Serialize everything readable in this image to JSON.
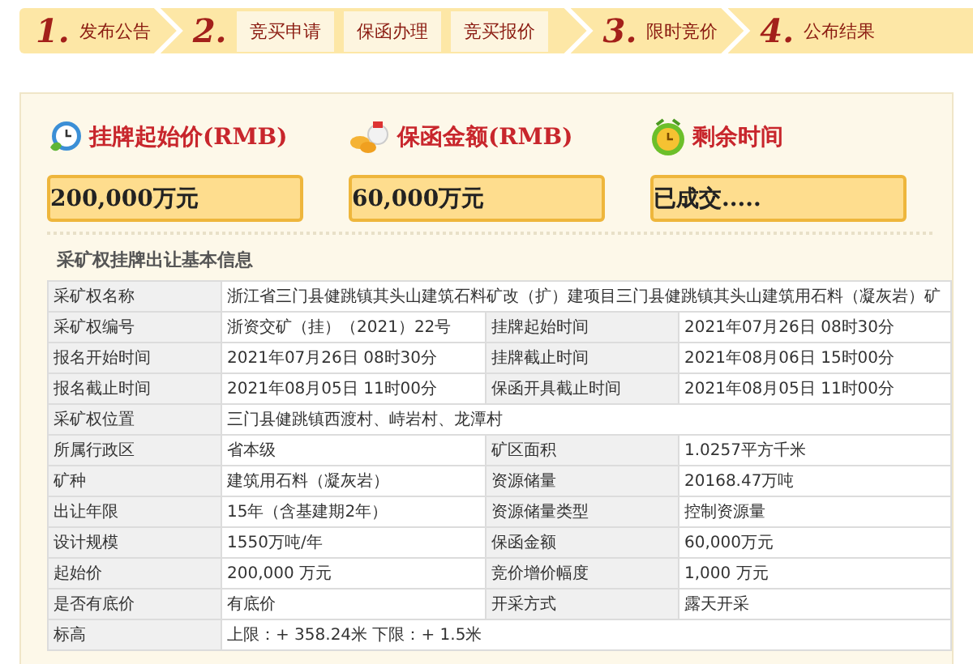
{
  "steps": [
    {
      "number": "1.",
      "label": "发布公告"
    },
    {
      "number": "2.",
      "substeps": [
        "竞买申请",
        "保函办理",
        "竞买报价"
      ]
    },
    {
      "number": "3.",
      "label": "限时竞价"
    },
    {
      "number": "4.",
      "label": "公布结果"
    }
  ],
  "metrics": [
    {
      "kind": "price",
      "title": "挂牌起始价(RMB)",
      "value": "200,000万元"
    },
    {
      "kind": "guarantee",
      "title": "保函金额(RMB)",
      "value": "60,000万元"
    },
    {
      "kind": "time",
      "title": "剩余时间",
      "value": "已成交....."
    }
  ],
  "section_title": "采矿权挂牌出让基本信息",
  "rows": [
    {
      "cells": [
        {
          "label": "采矿权名称",
          "value": "浙江省三门县健跳镇其头山建筑石料矿改（扩）建项目三门县健跳镇其头山建筑用石料（凝灰岩）矿"
        }
      ]
    },
    {
      "cells": [
        {
          "label": "采矿权编号",
          "value": "浙资交矿（挂）（2021）22号"
        },
        {
          "label": "挂牌起始时间",
          "value": "2021年07月26日 08时30分"
        }
      ]
    },
    {
      "cells": [
        {
          "label": "报名开始时间",
          "value": "2021年07月26日 08时30分"
        },
        {
          "label": "挂牌截止时间",
          "value": "2021年08月06日 15时00分"
        }
      ]
    },
    {
      "cells": [
        {
          "label": "报名截止时间",
          "value": "2021年08月05日 11时00分"
        },
        {
          "label": "保函开具截止时间",
          "value": "2021年08月05日 11时00分"
        }
      ]
    },
    {
      "cells": [
        {
          "label": "采矿权位置",
          "value": "三门县健跳镇西渡村、峙岩村、龙潭村"
        }
      ]
    },
    {
      "cells": [
        {
          "label": "所属行政区",
          "value": "省本级"
        },
        {
          "label": "矿区面积",
          "value": "1.0257平方千米"
        }
      ]
    },
    {
      "cells": [
        {
          "label": "矿种",
          "value": "建筑用石料（凝灰岩）"
        },
        {
          "label": "资源储量",
          "value": "20168.47万吨"
        }
      ]
    },
    {
      "cells": [
        {
          "label": "出让年限",
          "value": "15年（含基建期2年）"
        },
        {
          "label": "资源储量类型",
          "value": "控制资源量"
        }
      ]
    },
    {
      "cells": [
        {
          "label": "设计规模",
          "value": "1550万吨/年"
        },
        {
          "label": "保函金额",
          "value": "60,000万元"
        }
      ]
    },
    {
      "cells": [
        {
          "label": "起始价",
          "value": "200,000 万元"
        },
        {
          "label": "竞价增价幅度",
          "value": "1,000 万元"
        }
      ]
    },
    {
      "cells": [
        {
          "label": "是否有底价",
          "value": "有底价"
        },
        {
          "label": "开采方式",
          "value": "露天开采"
        }
      ]
    },
    {
      "cells": [
        {
          "label": "标高",
          "value": "上限：+ 358.24米 下限：+ 1.5米"
        }
      ]
    }
  ]
}
